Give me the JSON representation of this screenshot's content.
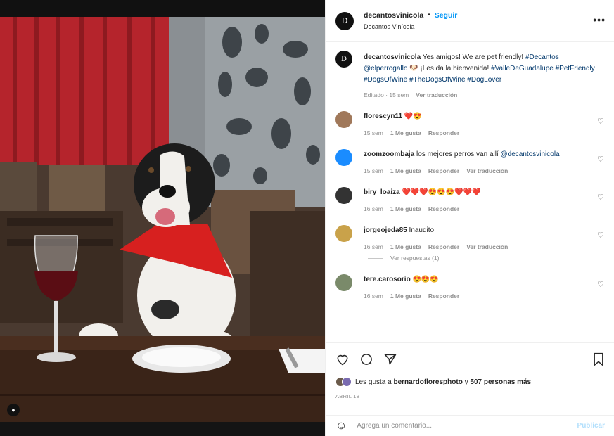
{
  "post": {
    "username": "decantosvinicola",
    "separator": "•",
    "follow_label": "Seguir",
    "location": "Decantos Vinícola",
    "more_icon": "more-horizontal-icon"
  },
  "caption": {
    "username": "decantosvinicola",
    "text_1": "Yes amigos! We are pet friendly! ",
    "tag_1": "#Decantos",
    "mention": "@elperrogallo",
    "text_2": " 🐶 ¡Les da la bienvenida! ",
    "tags_2": "#ValleDeGuadalupe #PetFriendly #DogsOfWine #TheDogsOfWine #DogLover",
    "edited": "Editado · 15 sem",
    "translate": "Ver traducción"
  },
  "comments": [
    {
      "username": "florescyn11",
      "text": "❤️😍",
      "time": "15 sem",
      "likes": "1 Me gusta",
      "reply": "Responder",
      "translate": ""
    },
    {
      "username": "zoomzoombaja",
      "text": "los mejores perros van allí ",
      "mention": "@decantosvinicola",
      "time": "15 sem",
      "likes": "1 Me gusta",
      "reply": "Responder",
      "translate": "Ver traducción"
    },
    {
      "username": "biry_loaiza",
      "text": "❤️❤️❤️😍😍😍❤️❤️❤️",
      "time": "16 sem",
      "likes": "1 Me gusta",
      "reply": "Responder",
      "translate": ""
    },
    {
      "username": "jorgeojeda85",
      "text": "Inaudito!",
      "time": "16 sem",
      "likes": "1 Me gusta",
      "reply": "Responder",
      "translate": "Ver traducción",
      "view_replies": "Ver respuestas (1)"
    },
    {
      "username": "tere.carosorio",
      "text": "😍😍😍",
      "time": "16 sem",
      "likes": "1 Me gusta",
      "reply": "Responder",
      "translate": ""
    }
  ],
  "likes": {
    "prefix": "Les gusta a ",
    "user": "bernardofloresphoto",
    "middle": " y ",
    "count": "507 personas más"
  },
  "date": "ABRIL 18",
  "add_comment": {
    "placeholder": "Agrega un comentario...",
    "publish": "Publicar"
  },
  "colors": {
    "accent": "#0095f6",
    "heart": "#ed4956",
    "muted": "#8e8e8e"
  }
}
